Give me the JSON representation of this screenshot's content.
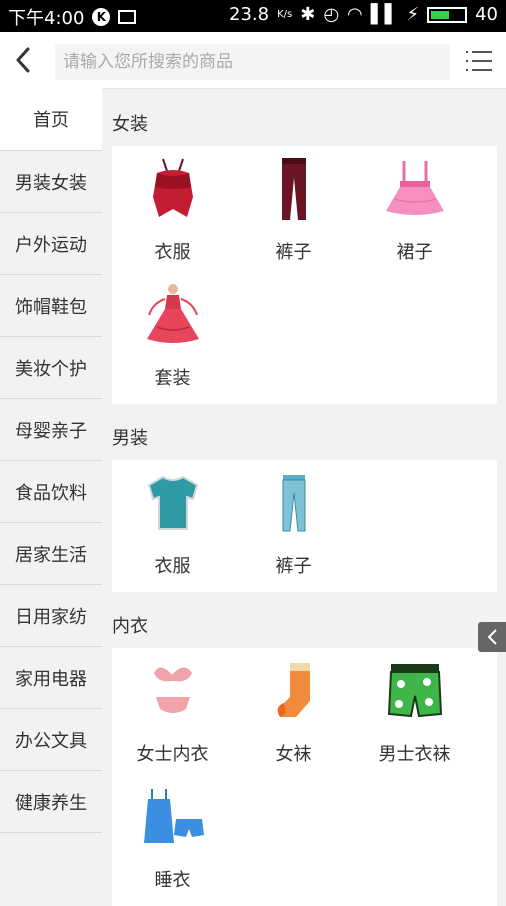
{
  "status_bar": {
    "time": "下午4:00",
    "speed": "23.8",
    "speed_unit": "K/s",
    "battery": "40"
  },
  "header": {
    "search_placeholder": "请输入您所搜索的商品"
  },
  "sidebar": {
    "items": [
      {
        "label": "首页",
        "active": true
      },
      {
        "label": "男装女装"
      },
      {
        "label": "户外运动"
      },
      {
        "label": "饰帽鞋包"
      },
      {
        "label": "美妆个护"
      },
      {
        "label": "母婴亲子"
      },
      {
        "label": "食品饮料"
      },
      {
        "label": "居家生活"
      },
      {
        "label": "日用家纺"
      },
      {
        "label": "家用电器"
      },
      {
        "label": "办公文具"
      },
      {
        "label": "健康养生"
      }
    ]
  },
  "sections": [
    {
      "title": "女装",
      "items": [
        {
          "label": "衣服",
          "icon": "red-top-icon"
        },
        {
          "label": "裤子",
          "icon": "dark-red-trousers-icon"
        },
        {
          "label": "裙子",
          "icon": "pink-skirt-icon"
        },
        {
          "label": "套装",
          "icon": "red-gown-icon"
        }
      ]
    },
    {
      "title": "男装",
      "items": [
        {
          "label": "衣服",
          "icon": "teal-tshirt-icon"
        },
        {
          "label": "裤子",
          "icon": "blue-jeans-icon"
        }
      ]
    },
    {
      "title": "内衣",
      "items": [
        {
          "label": "女士内衣",
          "icon": "pink-lingerie-icon"
        },
        {
          "label": "女袜",
          "icon": "orange-sock-icon"
        },
        {
          "label": "男士衣袜",
          "icon": "green-boxer-shorts-icon"
        },
        {
          "label": "睡衣",
          "icon": "blue-pajamas-icon"
        }
      ]
    }
  ],
  "colors": {
    "background": "#f2f2f2",
    "panel": "#ffffff",
    "text": "#333333",
    "placeholder": "#aaaaaa"
  }
}
